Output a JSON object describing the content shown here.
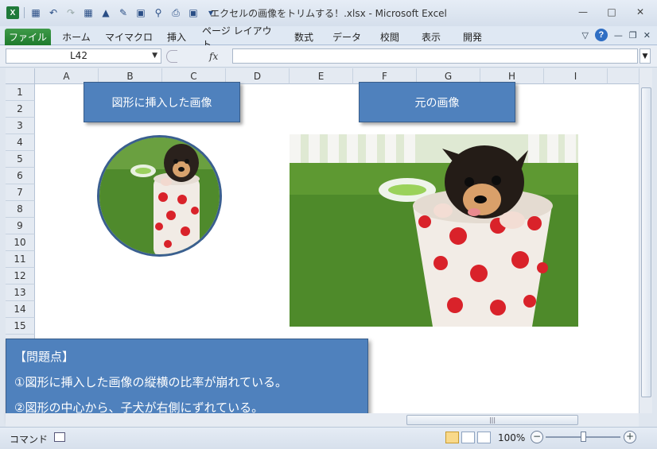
{
  "window": {
    "title": "エクセルの画像をトリムする！.xlsx - Microsoft Excel"
  },
  "ribbon": {
    "tabs": [
      "ファイル",
      "ホーム",
      "マイマクロ",
      "挿入",
      "ページ レイアウト",
      "数式",
      "データ",
      "校閲",
      "表示",
      "開発"
    ]
  },
  "formula_bar": {
    "name_box": "L42",
    "fx": "fx",
    "formula": ""
  },
  "grid": {
    "columns": [
      "A",
      "B",
      "C",
      "D",
      "E",
      "F",
      "G",
      "H",
      "I"
    ],
    "rows": [
      "1",
      "2",
      "3",
      "4",
      "5",
      "6",
      "7",
      "8",
      "9",
      "10",
      "11",
      "12",
      "13",
      "14",
      "15"
    ]
  },
  "shapes": {
    "label_left": "図形に挿入した画像",
    "label_right": "元の画像",
    "note": {
      "heading": "【問題点】",
      "line1": "①図形に挿入した画像の縦横の比率が崩れている。",
      "line2": "②図形の中心から、子犬が右側にずれている。"
    }
  },
  "status": {
    "mode": "コマンド",
    "zoom": "100%"
  },
  "colors": {
    "shape_fill": "#4f81bd",
    "shape_border": "#385d8a",
    "file_tab": "#1e7b2c"
  }
}
